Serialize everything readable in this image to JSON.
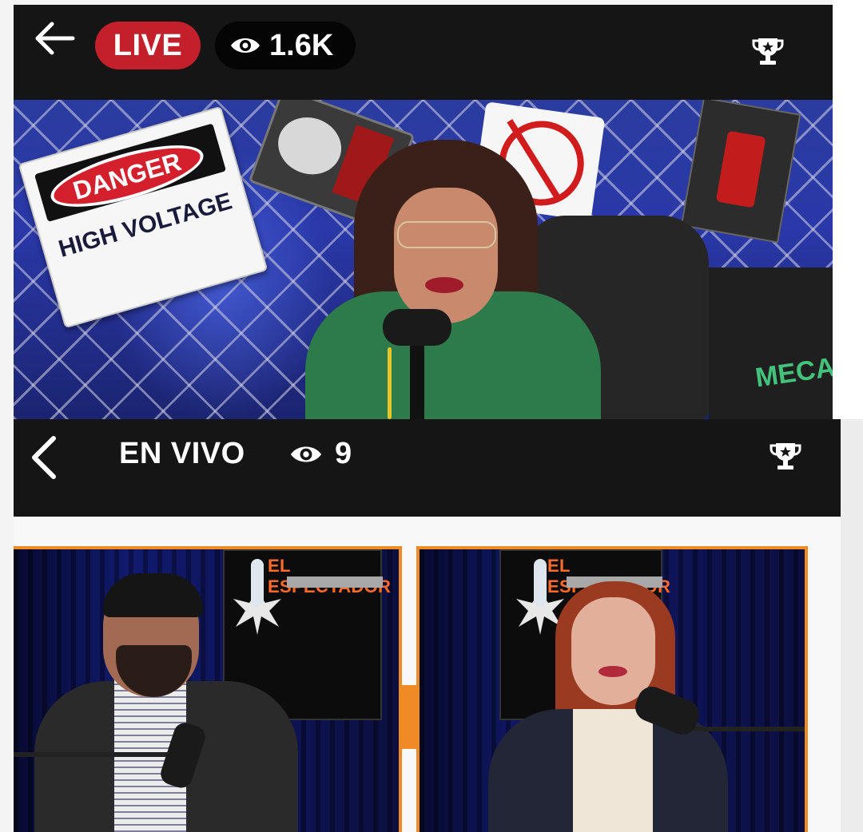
{
  "top_stream": {
    "live_label": "LIVE",
    "viewer_count": "1.6K",
    "icons": {
      "back": "back-arrow-icon",
      "eye": "eye-icon",
      "trophy": "trophy-icon"
    },
    "colors": {
      "live_badge": "#c4202c",
      "bar": "#151515"
    },
    "scene_text": {
      "danger": "DANGER",
      "danger_sub": "HIGH VOLTAGE",
      "shirt": "MECAN"
    }
  },
  "second_stream": {
    "status_label": "EN VIVO",
    "viewer_count": "9",
    "icons": {
      "back": "chevron-left-icon",
      "eye": "eye-icon",
      "trophy": "trophy-icon"
    },
    "colors": {
      "frame_border": "#f08a24",
      "bar": "#151515"
    },
    "scene_text": {
      "screen_title_left": "EL ESPECTADOR",
      "screen_title_right": "EL ESPECTADOR"
    }
  }
}
